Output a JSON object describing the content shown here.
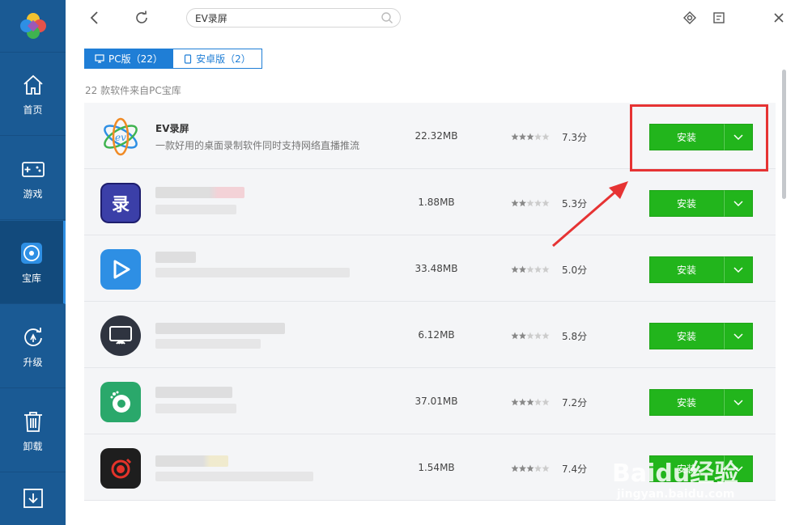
{
  "sidebar": {
    "items": [
      {
        "label": "首页",
        "icon": "home-icon"
      },
      {
        "label": "游戏",
        "icon": "gamepad-icon"
      },
      {
        "label": "宝库",
        "icon": "disc-icon"
      },
      {
        "label": "升级",
        "icon": "upgrade-icon"
      },
      {
        "label": "卸载",
        "icon": "trash-icon"
      },
      {
        "label": "",
        "icon": "download-icon"
      }
    ],
    "active": "宝库",
    "colors": {
      "bg": "#1a5a94",
      "active": "#124a7c"
    }
  },
  "topbar": {
    "search_value": "EV录屏",
    "icons": [
      "back-icon",
      "refresh-icon",
      "search-icon",
      "settings-icon",
      "restore-icon",
      "close-icon"
    ]
  },
  "tabs": [
    {
      "label": "PC版（22）",
      "icon": "monitor-icon",
      "active": true
    },
    {
      "label": "安卓版（2）",
      "icon": "phone-icon",
      "active": false
    }
  ],
  "subtitle": "22 款软件来自PC宝库",
  "install_label": "安装",
  "apps": [
    {
      "name": "EV录屏",
      "desc": "一款好用的桌面录制软件同时支持网络直播推流",
      "size": "22.32MB",
      "rating": 3.5,
      "score": "7.3分",
      "blurred": false
    },
    {
      "name": "",
      "desc": "",
      "size": "1.88MB",
      "rating": 2.5,
      "score": "5.3分",
      "blurred": true
    },
    {
      "name": "",
      "desc": "",
      "size": "33.48MB",
      "rating": 2.5,
      "score": "5.0分",
      "blurred": true
    },
    {
      "name": "",
      "desc": "",
      "size": "6.12MB",
      "rating": 2.5,
      "score": "5.8分",
      "blurred": true
    },
    {
      "name": "",
      "desc": "",
      "size": "37.01MB",
      "rating": 3.5,
      "score": "7.2分",
      "blurred": true
    },
    {
      "name": "",
      "desc": "",
      "size": "1.54MB",
      "rating": 3.5,
      "score": "7.4分",
      "blurred": true
    }
  ],
  "watermark": {
    "text": "Baidu经验",
    "url": "jingyan.baidu.com"
  },
  "colors": {
    "accent": "#1f7ed6",
    "install": "#22b51c",
    "annotation": "#e63333"
  }
}
